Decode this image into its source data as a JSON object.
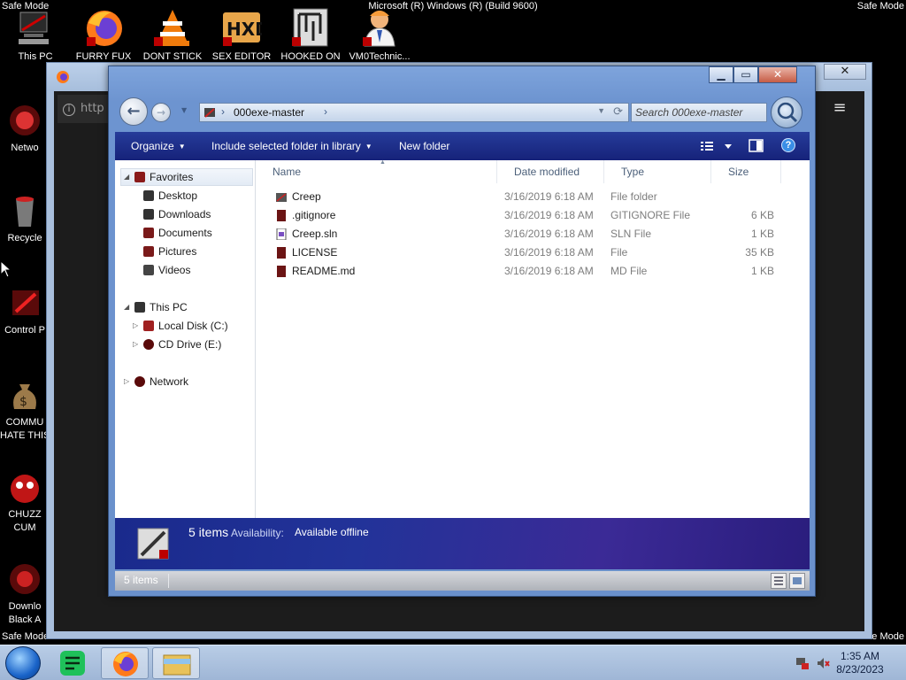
{
  "desktop": {
    "safe_mode_label": "Safe Mode",
    "build_label": "Microsoft (R) Windows (R) (Build 9600)",
    "top_icons": [
      {
        "label": "This PC",
        "icon": "pc-icon"
      },
      {
        "label": "FURRY FUX",
        "icon": "firefox-icon"
      },
      {
        "label": "DONT STICK",
        "icon": "vlc-icon"
      },
      {
        "label": "SEX EDITOR",
        "icon": "hxd-icon"
      },
      {
        "label": "HOOKED ON",
        "icon": "maze-icon"
      },
      {
        "label": "VM0Technic...",
        "icon": "technician-icon"
      }
    ],
    "left_icons": [
      {
        "label": "Netwo",
        "icon": "network-icon"
      },
      {
        "label": "Recycle",
        "icon": "recycle-bin-icon"
      },
      {
        "label": "Control P",
        "icon": "control-panel-icon"
      },
      {
        "label": "COMMU",
        "label2": "HATE THIS",
        "icon": "money-bag-icon"
      },
      {
        "label": "CHUZZ",
        "label2": "CUM",
        "icon": "chuzzle-icon"
      },
      {
        "label": "Downlo",
        "label2": "Black A",
        "icon": "download-icon"
      }
    ]
  },
  "browser": {
    "url_fragment": "http",
    "close_glyph": "✕",
    "menu_glyph": "≡"
  },
  "explorer": {
    "window_buttons": {
      "minimize": "▁",
      "maximize": "▭",
      "close": "✕"
    },
    "address": {
      "path_segment": "000exe-master",
      "separator": "›"
    },
    "search_placeholder": "Search 000exe-master",
    "commands": {
      "organize": "Organize",
      "include": "Include selected folder in library",
      "new_folder": "New folder"
    },
    "nav": {
      "favorites": "Favorites",
      "favorite_items": [
        "Desktop",
        "Downloads",
        "Documents",
        "Pictures",
        "Videos"
      ],
      "this_pc": "This PC",
      "drives": [
        "Local Disk (C:)",
        "CD Drive (E:)"
      ],
      "network": "Network"
    },
    "columns": {
      "name": "Name",
      "date": "Date modified",
      "type": "Type",
      "size": "Size"
    },
    "files": [
      {
        "name": "Creep",
        "date": "3/16/2019 6:18 AM",
        "type": "File folder",
        "size": ""
      },
      {
        "name": ".gitignore",
        "date": "3/16/2019 6:18 AM",
        "type": "GITIGNORE File",
        "size": "6 KB"
      },
      {
        "name": "Creep.sln",
        "date": "3/16/2019 6:18 AM",
        "type": "SLN File",
        "size": "1 KB"
      },
      {
        "name": "LICENSE",
        "date": "3/16/2019 6:18 AM",
        "type": "File",
        "size": "35 KB"
      },
      {
        "name": "README.md",
        "date": "3/16/2019 6:18 AM",
        "type": "MD File",
        "size": "1 KB"
      }
    ],
    "details": {
      "count": "5 items",
      "availability_label": "Availability:",
      "availability_value": "Available offline"
    },
    "status": {
      "count": "5 items"
    }
  },
  "taskbar": {
    "time": "1:35 AM",
    "date": "8/23/2023"
  },
  "colors": {
    "accent": "#1b2e92",
    "window_frame": "#6d94d0",
    "taskbar": "#a9bfdc"
  }
}
